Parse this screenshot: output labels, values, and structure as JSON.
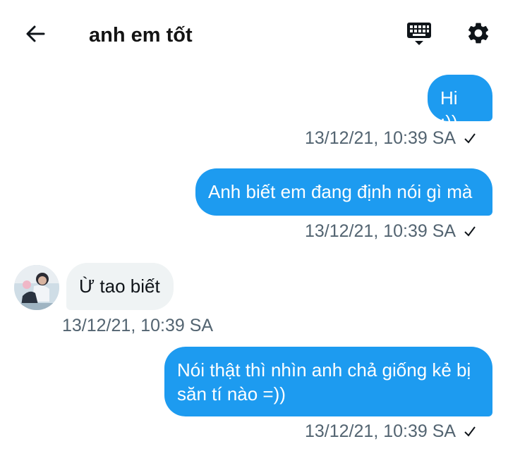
{
  "header": {
    "title": "anh em tốt",
    "back_icon": "arrow-left-icon",
    "keyboard_icon": "keyboard-icon",
    "settings_icon": "gear-icon"
  },
  "colors": {
    "accent": "#1d9bf0",
    "incoming_bubble": "#eff3f4",
    "meta_text": "#536471"
  },
  "messages": [
    {
      "direction": "outgoing",
      "text": "Hi :))",
      "time": "13/12/21, 10:39 SA",
      "status_icon": "check-icon"
    },
    {
      "direction": "outgoing",
      "text": "Anh biết em đang định nói gì mà",
      "time": "13/12/21, 10:39 SA",
      "status_icon": "check-icon"
    },
    {
      "direction": "incoming",
      "text": "Ừ tao biết",
      "time": "13/12/21, 10:39 SA"
    },
    {
      "direction": "outgoing",
      "text": "Nói thật thì nhìn anh chả giống kẻ bị săn tí nào =))",
      "time": "13/12/21, 10:39 SA",
      "status_icon": "check-icon"
    }
  ]
}
